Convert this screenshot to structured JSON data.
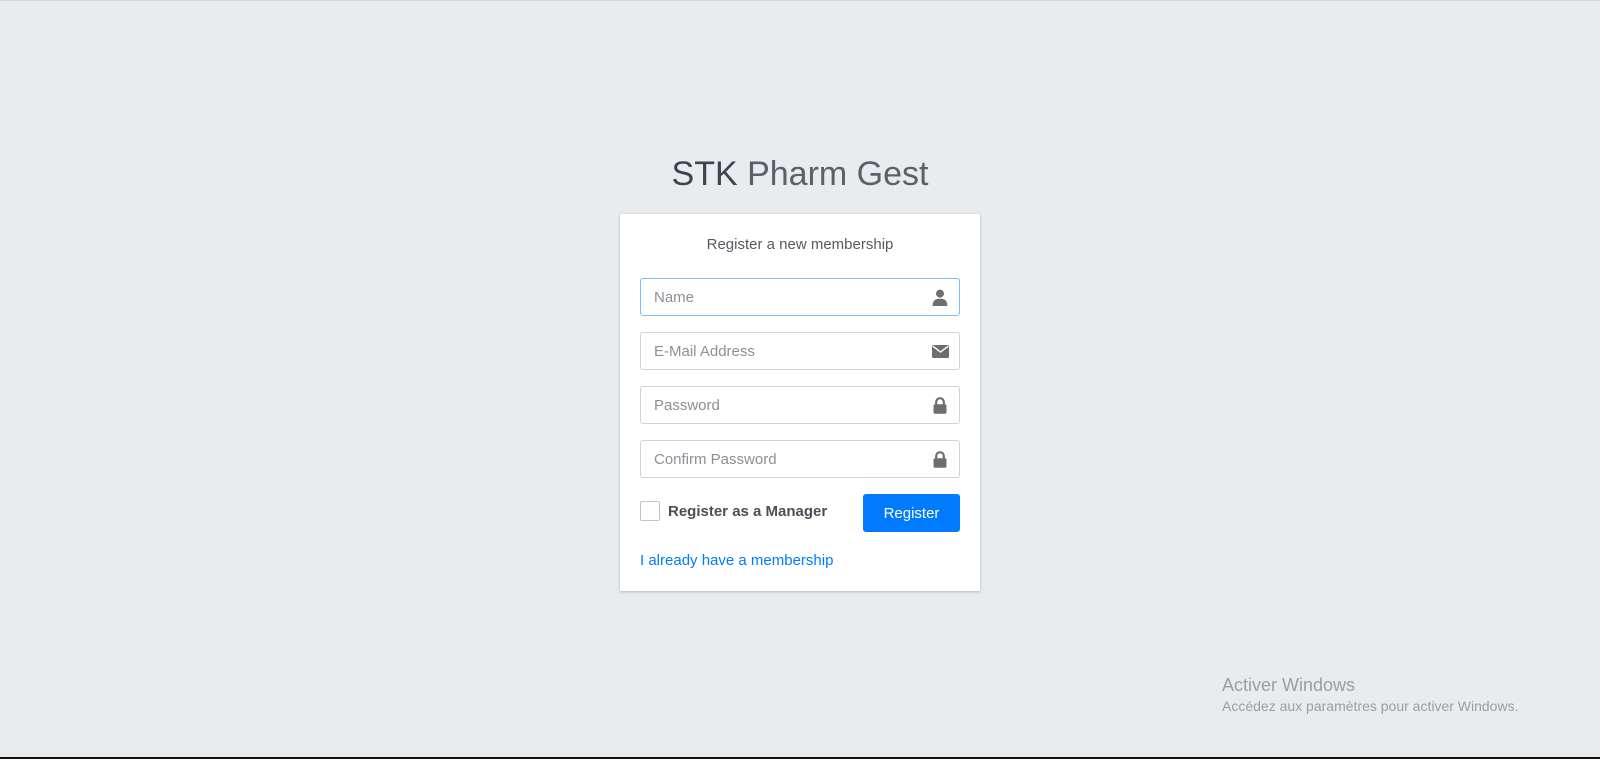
{
  "brand": {
    "strong": "STK",
    "light": "Pharm Gest"
  },
  "card": {
    "message": "Register a new membership",
    "fields": {
      "name": {
        "placeholder": "Name",
        "value": "",
        "icon": "user-icon"
      },
      "email": {
        "placeholder": "E-Mail Address",
        "value": "",
        "icon": "envelope-icon"
      },
      "password": {
        "placeholder": "Password",
        "value": "",
        "icon": "lock-icon"
      },
      "confirm_password": {
        "placeholder": "Confirm Password",
        "value": "",
        "icon": "lock-icon"
      }
    },
    "manager_checkbox_label": "Register as a Manager",
    "manager_checked": false,
    "register_button": "Register",
    "login_link": "I already have a membership"
  },
  "watermark": {
    "title": "Activer Windows",
    "subtitle": "Accédez aux paramètres pour activer Windows."
  },
  "colors": {
    "background": "#e9ecef",
    "primary": "#007bff",
    "text": "#495057",
    "icon": "#6c6f72"
  }
}
